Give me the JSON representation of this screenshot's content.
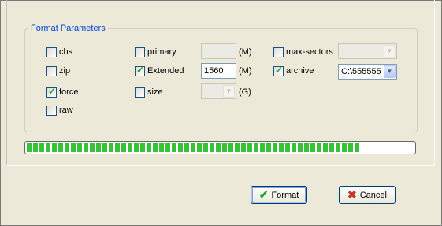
{
  "group": {
    "title": "Format Parameters"
  },
  "checkboxes": {
    "chs": {
      "label": "chs",
      "checked": false
    },
    "zip": {
      "label": "zip",
      "checked": false
    },
    "force": {
      "label": "force",
      "checked": true
    },
    "raw": {
      "label": "raw",
      "checked": false
    },
    "primary": {
      "label": "primary",
      "checked": false
    },
    "extended": {
      "label": "Extended",
      "checked": true
    },
    "size": {
      "label": "size",
      "checked": false
    },
    "max_sectors": {
      "label": "max-sectors",
      "checked": false
    },
    "archive": {
      "label": "archive",
      "checked": true
    }
  },
  "fields": {
    "primary_value": "",
    "extended_value": "1560",
    "size_value": "",
    "max_sectors_value": "",
    "archive_value": "C:\\555555"
  },
  "units": {
    "primary": "(M)",
    "extended": "(M)",
    "size": "(G)"
  },
  "progress": {
    "percent": 86
  },
  "buttons": {
    "format": "Format",
    "cancel": "Cancel"
  },
  "icons": {
    "format": "checkmark-icon",
    "cancel": "x-icon"
  },
  "colors": {
    "group_title": "#0046d5",
    "progress_fill": "#38c238",
    "check_tick": "#21a121",
    "cancel_x": "#c0392b"
  }
}
